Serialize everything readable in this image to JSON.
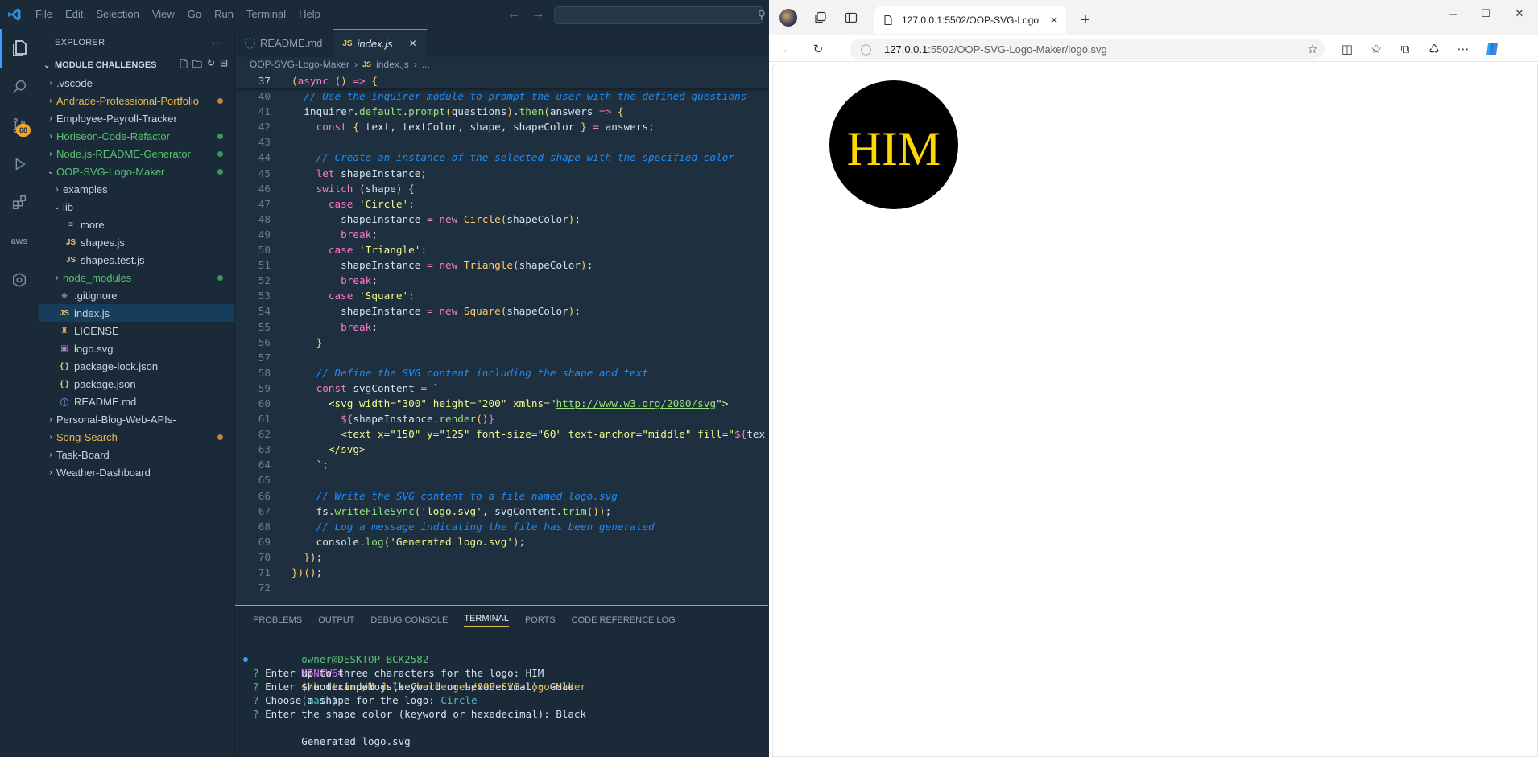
{
  "vscode": {
    "menu": [
      "File",
      "Edit",
      "Selection",
      "View",
      "Go",
      "Run",
      "Terminal",
      "Help"
    ],
    "explorer": {
      "title": "EXPLORER",
      "section": "MODULE CHALLENGES",
      "items": [
        {
          "label": ".vscode",
          "kind": "folder",
          "depth": 0,
          "color": "default"
        },
        {
          "label": "Andrade-Professional-Portfolio",
          "kind": "folder",
          "depth": 0,
          "color": "orange",
          "dot": "orange"
        },
        {
          "label": "Employee-Payroll-Tracker",
          "kind": "folder",
          "depth": 0,
          "color": "default"
        },
        {
          "label": "Horiseon-Code-Refactor",
          "kind": "folder",
          "depth": 0,
          "color": "green",
          "dot": "green"
        },
        {
          "label": "Node.js-README-Generator",
          "kind": "folder",
          "depth": 0,
          "color": "green",
          "dot": "green"
        },
        {
          "label": "OOP-SVG-Logo-Maker",
          "kind": "folder-open",
          "depth": 0,
          "color": "green",
          "dot": "green"
        },
        {
          "label": "examples",
          "kind": "folder",
          "depth": 1,
          "color": "default"
        },
        {
          "label": "lib",
          "kind": "folder-open",
          "depth": 1,
          "color": "default"
        },
        {
          "label": "more",
          "kind": "file-more",
          "depth": 2,
          "color": "default"
        },
        {
          "label": "shapes.js",
          "kind": "js",
          "depth": 2,
          "color": "default"
        },
        {
          "label": "shapes.test.js",
          "kind": "js",
          "depth": 2,
          "color": "default"
        },
        {
          "label": "node_modules",
          "kind": "folder",
          "depth": 1,
          "color": "green",
          "dot": "green"
        },
        {
          "label": ".gitignore",
          "kind": "gitignore",
          "depth": 1,
          "color": "default"
        },
        {
          "label": "index.js",
          "kind": "js",
          "depth": 1,
          "color": "default",
          "selected": true
        },
        {
          "label": "LICENSE",
          "kind": "license",
          "depth": 1,
          "color": "default"
        },
        {
          "label": "logo.svg",
          "kind": "svg",
          "depth": 1,
          "color": "default"
        },
        {
          "label": "package-lock.json",
          "kind": "json",
          "depth": 1,
          "color": "default"
        },
        {
          "label": "package.json",
          "kind": "json",
          "depth": 1,
          "color": "default"
        },
        {
          "label": "README.md",
          "kind": "info",
          "depth": 1,
          "color": "default"
        },
        {
          "label": "Personal-Blog-Web-APIs-",
          "kind": "folder",
          "depth": 0,
          "color": "default"
        },
        {
          "label": "Song-Search",
          "kind": "folder",
          "depth": 0,
          "color": "orange",
          "dot": "orange"
        },
        {
          "label": "Task-Board",
          "kind": "folder",
          "depth": 0,
          "color": "default"
        },
        {
          "label": "Weather-Dashboard",
          "kind": "folder",
          "depth": 0,
          "color": "default"
        }
      ]
    },
    "badge": "68",
    "tabs": [
      {
        "label": "README.md",
        "active": false
      },
      {
        "label": "index.js",
        "active": true
      }
    ],
    "breadcrumb": [
      "OOP-SVG-Logo-Maker",
      "index.js",
      "..."
    ],
    "code": [
      {
        "n": "37",
        "html": "<span class='p'>(</span><span class='k'>async</span> <span class='p'>()</span> <span class='op'>=&gt;</span> <span class='p'>{</span>",
        "sticky": true
      },
      {
        "n": "40",
        "html": "  <span class='cm'>// Use the inquirer module to prompt the user with the defined questions</span>"
      },
      {
        "n": "41",
        "html": "  inquirer.<span class='f'>default</span>.<span class='f'>prompt</span><span class='p'>(</span>questions<span class='p'>)</span>.<span class='f'>then</span><span class='p'>(</span>answers <span class='op'>=&gt;</span> <span class='p'>{</span>"
      },
      {
        "n": "42",
        "html": "    <span class='k'>const</span> <span class='p'>{</span> text, textColor, shape, shapeColor <span class='p'>}</span> <span class='op'>=</span> answers;"
      },
      {
        "n": "43",
        "html": ""
      },
      {
        "n": "44",
        "html": "    <span class='cm'>// Create an instance of the selected shape with the specified color</span>"
      },
      {
        "n": "45",
        "html": "    <span class='k'>let</span> shapeInstance;"
      },
      {
        "n": "46",
        "html": "    <span class='k'>switch</span> <span class='p'>(</span>shape<span class='p'>)</span> <span class='p'>{</span>"
      },
      {
        "n": "47",
        "html": "      <span class='k'>case</span> <span class='s'>'Circle'</span>:"
      },
      {
        "n": "48",
        "html": "        shapeInstance <span class='op'>=</span> <span class='k'>new</span> <span class='cl'>Circle</span><span class='p'>(</span>shapeColor<span class='p'>)</span>;"
      },
      {
        "n": "49",
        "html": "        <span class='k'>break</span>;"
      },
      {
        "n": "50",
        "html": "      <span class='k'>case</span> <span class='s'>'Triangle'</span>:"
      },
      {
        "n": "51",
        "html": "        shapeInstance <span class='op'>=</span> <span class='k'>new</span> <span class='cl'>Triangle</span><span class='p'>(</span>shapeColor<span class='p'>)</span>;"
      },
      {
        "n": "52",
        "html": "        <span class='k'>break</span>;"
      },
      {
        "n": "53",
        "html": "      <span class='k'>case</span> <span class='s'>'Square'</span>:"
      },
      {
        "n": "54",
        "html": "        shapeInstance <span class='op'>=</span> <span class='k'>new</span> <span class='cl'>Square</span><span class='p'>(</span>shapeColor<span class='p'>)</span>;"
      },
      {
        "n": "55",
        "html": "        <span class='k'>break</span>;"
      },
      {
        "n": "56",
        "html": "    <span class='p'>}</span>"
      },
      {
        "n": "57",
        "html": ""
      },
      {
        "n": "58",
        "html": "    <span class='cm'>// Define the SVG content including the shape and text</span>"
      },
      {
        "n": "59",
        "html": "    <span class='k'>const</span> svgContent <span class='op'>=</span> <span class='s'>`</span>"
      },
      {
        "n": "60",
        "html": "      <span class='s'>&lt;svg width=\"300\" height=\"200\" xmlns=\"</span><span class='u'>http://www.w3.org/2000/svg</span><span class='s'>\"&gt;</span>"
      },
      {
        "n": "61",
        "html": "        <span class='k'>${</span>shapeInstance.<span class='f'>render</span><span class='p'>()</span><span class='k'>}</span>"
      },
      {
        "n": "62",
        "html": "        <span class='s'>&lt;text x=\"150\" y=\"125\" font-size=\"60\" text-anchor=\"middle\" fill=\"</span><span class='k'>${</span>tex"
      },
      {
        "n": "63",
        "html": "      <span class='s'>&lt;/svg&gt;</span>"
      },
      {
        "n": "64",
        "html": "    <span class='s'>`</span>;"
      },
      {
        "n": "65",
        "html": ""
      },
      {
        "n": "66",
        "html": "    <span class='cm'>// Write the SVG content to a file named logo.svg</span>"
      },
      {
        "n": "67",
        "html": "    fs.<span class='f'>writeFileSync</span><span class='p'>(</span><span class='s'>'logo.svg'</span>, svgContent.<span class='f'>trim</span><span class='p'>()</span><span class='p'>)</span>;"
      },
      {
        "n": "68",
        "html": "    <span class='cm'>// Log a message indicating the file has been generated</span>"
      },
      {
        "n": "69",
        "html": "    console.<span class='f'>log</span><span class='p'>(</span><span class='s'>'Generated logo.svg'</span><span class='p'>)</span>;"
      },
      {
        "n": "70",
        "html": "  <span class='p'>})</span>;"
      },
      {
        "n": "71",
        "html": "<span class='p'>})()</span>;"
      },
      {
        "n": "72",
        "html": ""
      }
    ],
    "panel_tabs": [
      "PROBLEMS",
      "OUTPUT",
      "DEBUG CONSOLE",
      "TERMINAL",
      "PORTS",
      "CODE REFERENCE LOG"
    ],
    "panel_active": "TERMINAL",
    "terminal": {
      "user_host": "owner@DESKTOP-BCK2582",
      "shell": "MINGW64",
      "cwd": "~/bootcamp/Module Challenges/OOP-SVG-Logo-Maker",
      "branch": "(main)",
      "command": "$ node index.js",
      "prompts": [
        {
          "q": "Enter up to three characters for the logo:",
          "a": "HIM",
          "color": "plain"
        },
        {
          "q": "Enter the text color (keyword or hexadecimal):",
          "a": "Gold",
          "color": "plain"
        },
        {
          "q": "Choose a shape for the logo:",
          "a": "Circle",
          "color": "cyan"
        },
        {
          "q": "Enter the shape color (keyword or hexadecimal):",
          "a": "Black",
          "color": "plain"
        }
      ],
      "output": "Generated logo.svg"
    }
  },
  "browser": {
    "tab_title": "127.0.0.1:5502/OOP-SVG-Logo-M",
    "url_host": "127.0.0.1",
    "url_path": ":5502/OOP-SVG-Logo-Maker/logo.svg",
    "logo": {
      "text": "HIM",
      "text_color": "#FFD700",
      "shape": "circle",
      "shape_color": "#000000"
    }
  },
  "colors": {
    "accent": "#3b9cff",
    "gold": "#FFD700",
    "black": "#000000"
  }
}
